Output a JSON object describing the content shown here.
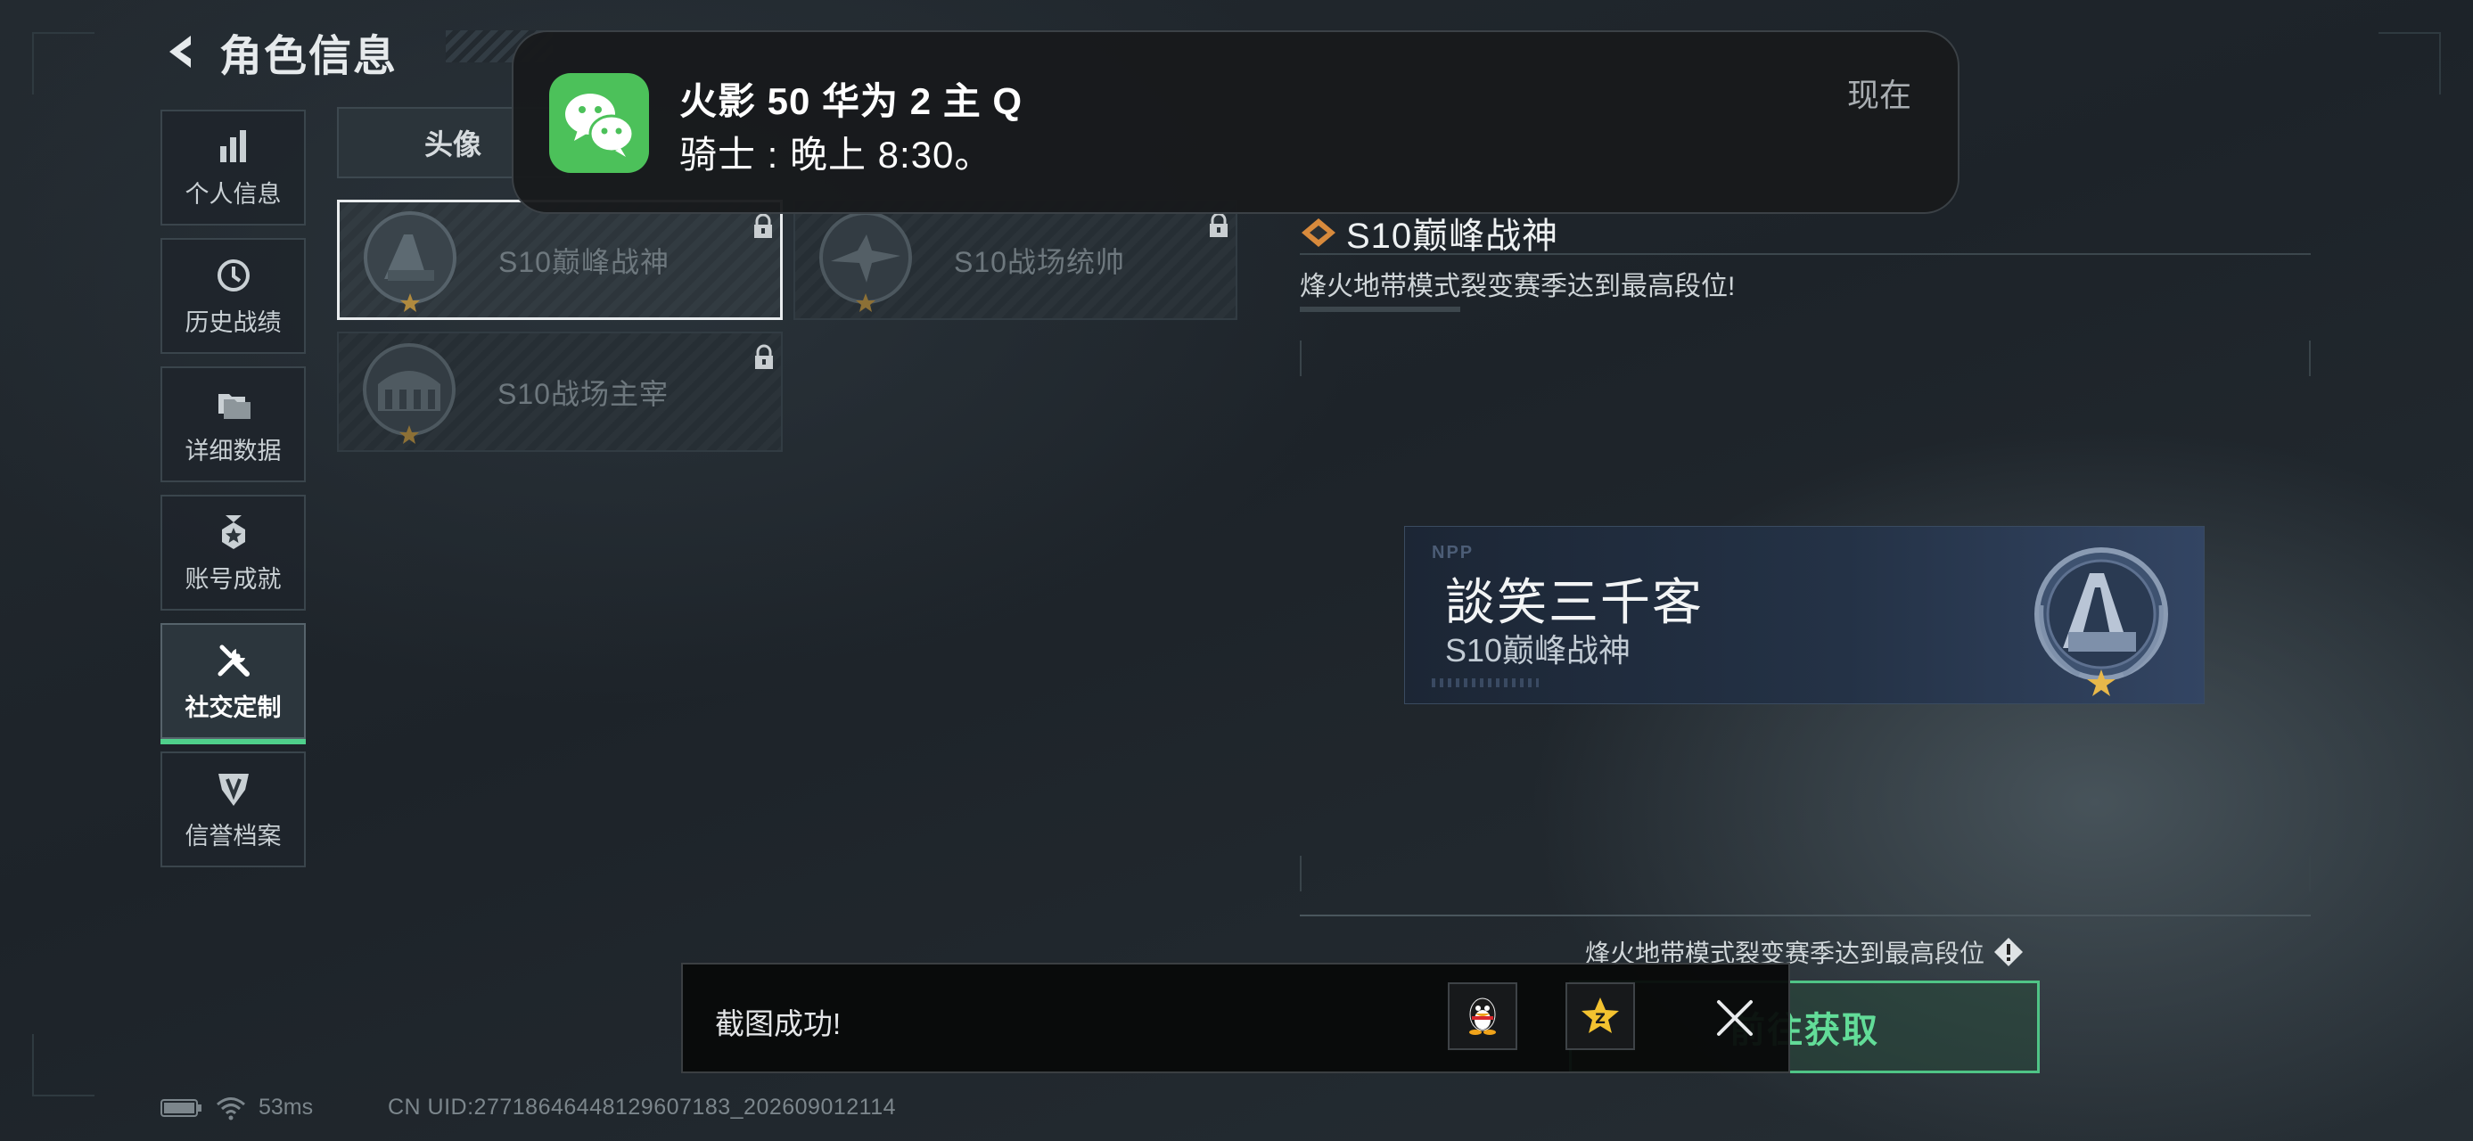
{
  "header": {
    "title": "角色信息"
  },
  "sidebar": {
    "items": [
      {
        "label": "个人信息",
        "icon": "bar-chart-icon",
        "active": false
      },
      {
        "label": "历史战绩",
        "icon": "history-clock-icon",
        "active": false
      },
      {
        "label": "详细数据",
        "icon": "folders-icon",
        "active": false
      },
      {
        "label": "账号成就",
        "icon": "medal-icon",
        "active": false
      },
      {
        "label": "社交定制",
        "icon": "tools-icon",
        "active": true
      },
      {
        "label": "信誉档案",
        "icon": "credit-shield-icon",
        "active": false
      }
    ]
  },
  "tabs": {
    "first_label": "头像"
  },
  "cards": [
    {
      "label": "S10巅峰战神",
      "selected": true,
      "locked": true
    },
    {
      "label": "S10战场统帅",
      "selected": false,
      "locked": true
    },
    {
      "label": "S10战场主宰",
      "selected": false,
      "locked": true
    }
  ],
  "detail": {
    "title": "S10巅峰战神",
    "description": "烽火地带模式裂变赛季达到最高段位!",
    "nameplate": {
      "player_name": "談笑三千客",
      "title": "S10巅峰战神"
    },
    "obtain_hint": "烽火地带模式裂变赛季达到最高段位",
    "obtain_button": "前往获取"
  },
  "status": {
    "ping": "53ms",
    "uid": "CN UID:27718646448129607183_202609012114"
  },
  "notification": {
    "app": "WeChat",
    "title": "火影 50 华为 2 主 Q",
    "body": "骑士 : 晚上 8:30。",
    "time": "现在"
  },
  "toast": {
    "text": "截图成功!"
  },
  "colors": {
    "accent_green": "#4fd08b",
    "wechat_green": "#4cc15a",
    "star_gold": "#e8b84a"
  }
}
